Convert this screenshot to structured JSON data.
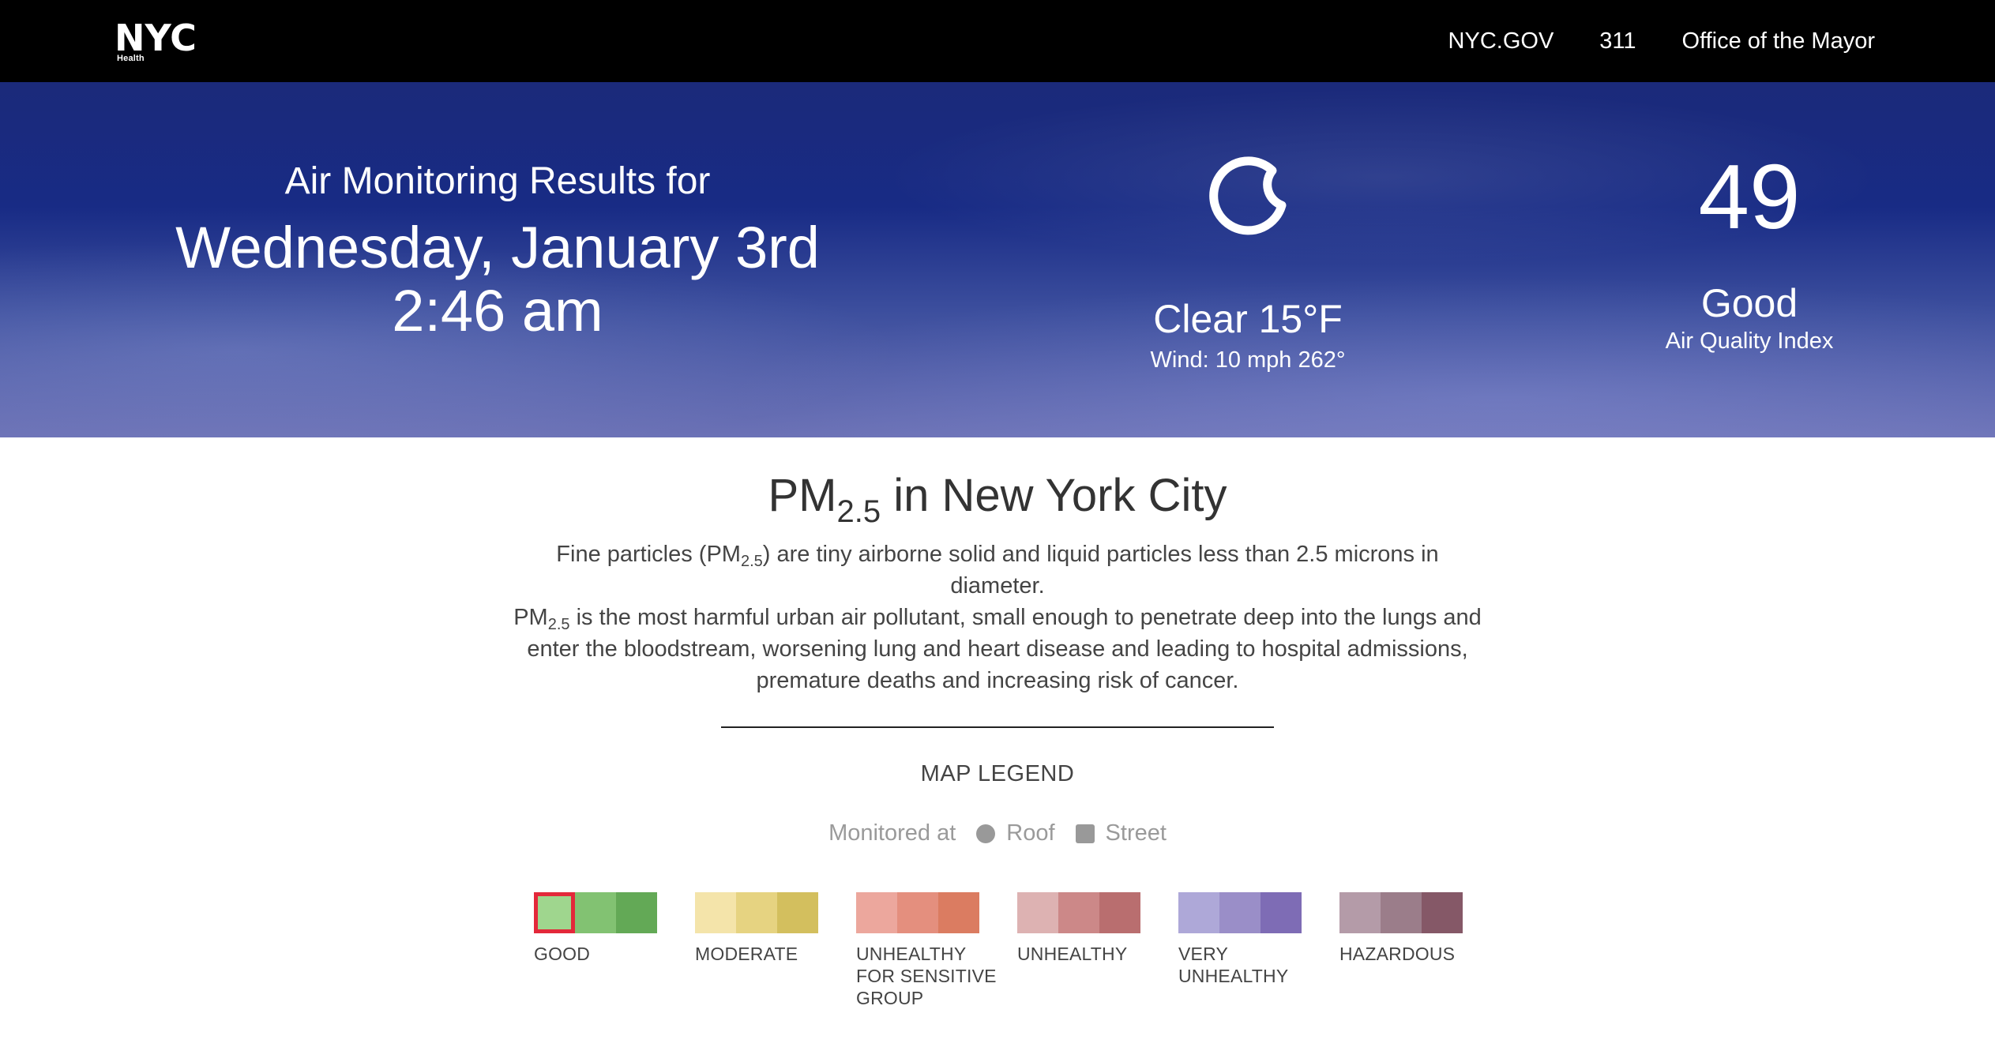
{
  "header": {
    "logo_text": "NYC",
    "logo_sub": "Health",
    "nav": [
      "NYC.GOV",
      "311",
      "Office of the Mayor"
    ]
  },
  "hero": {
    "subtitle": "Air Monitoring Results for",
    "date": "Wednesday, January 3rd",
    "time": "2:46 am",
    "weather_icon": "moon-icon",
    "weather_condition": "Clear 15°F",
    "wind": "Wind: 10 mph 262°",
    "aqi_value": "49",
    "aqi_label": "Good",
    "aqi_caption": "Air Quality Index"
  },
  "pm": {
    "title_prefix": "PM",
    "title_sub": "2.5",
    "title_suffix": " in New York City",
    "desc_line1_a": "Fine particles (PM",
    "desc_line1_sub": "2.5",
    "desc_line1_b": ") are tiny airborne solid and liquid particles less than 2.5 microns in diameter.",
    "desc_line2_a": "PM",
    "desc_line2_sub": "2.5",
    "desc_line2_b": " is the most harmful urban air pollutant, small enough to penetrate deep into the lungs and enter the bloodstream, worsening lung and heart disease and leading to hospital admissions, premature deaths and increasing risk of cancer."
  },
  "legend": {
    "title": "MAP LEGEND",
    "monitored_at": "Monitored at",
    "roof": "Roof",
    "street": "Street",
    "categories": [
      {
        "label": "GOOD",
        "colors": [
          "#9fd68e",
          "#82c272",
          "#63a956"
        ],
        "selected_index": 0
      },
      {
        "label": "MODERATE",
        "colors": [
          "#f4e4aa",
          "#e6d381",
          "#d3bf5e"
        ]
      },
      {
        "label": "UNHEALTHY FOR SENSITIVE GROUP",
        "colors": [
          "#eca79d",
          "#e48f7e",
          "#db7c61"
        ]
      },
      {
        "label": "UNHEALTHY",
        "colors": [
          "#ddb2b2",
          "#cc8888",
          "#b96e6f"
        ]
      },
      {
        "label": "VERY UNHEALTHY",
        "colors": [
          "#aea8d8",
          "#9a8ec8",
          "#7e6cb5"
        ]
      },
      {
        "label": "HAZARDOUS",
        "colors": [
          "#b49ba8",
          "#9b7d8a",
          "#855867"
        ]
      }
    ]
  }
}
